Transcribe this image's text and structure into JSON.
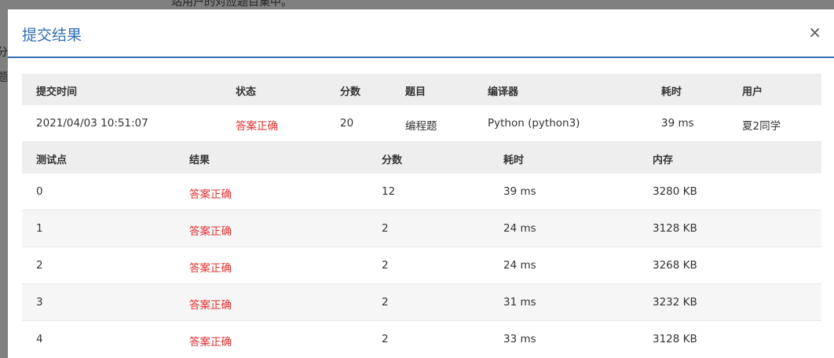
{
  "background": {
    "top_text": "站用户的对应题目集中。",
    "side_text_1": "分",
    "side_text_2": "题("
  },
  "modal": {
    "title": "提交结果",
    "close_label": "×"
  },
  "summary": {
    "headers": [
      "提交时间",
      "状态",
      "分数",
      "题目",
      "编译器",
      "耗时",
      "用户"
    ],
    "row": {
      "time": "2021/04/03 10:51:07",
      "status": "答案正确",
      "score": "20",
      "problem": "编程题",
      "compiler": "Python (python3)",
      "elapsed": "39 ms",
      "user": "夏2同学"
    }
  },
  "tests": {
    "headers": [
      "测试点",
      "结果",
      "分数",
      "耗时",
      "内存"
    ],
    "rows": [
      {
        "id": "0",
        "result": "答案正确",
        "score": "12",
        "time": "39 ms",
        "memory": "3280 KB"
      },
      {
        "id": "1",
        "result": "答案正确",
        "score": "2",
        "time": "24 ms",
        "memory": "3128 KB"
      },
      {
        "id": "2",
        "result": "答案正确",
        "score": "2",
        "time": "24 ms",
        "memory": "3268 KB"
      },
      {
        "id": "3",
        "result": "答案正确",
        "score": "2",
        "time": "31 ms",
        "memory": "3232 KB"
      },
      {
        "id": "4",
        "result": "答案正确",
        "score": "2",
        "time": "33 ms",
        "memory": "3128 KB"
      }
    ]
  },
  "colors": {
    "accent": "#2f6fb6",
    "status_ok": "#e03131"
  }
}
